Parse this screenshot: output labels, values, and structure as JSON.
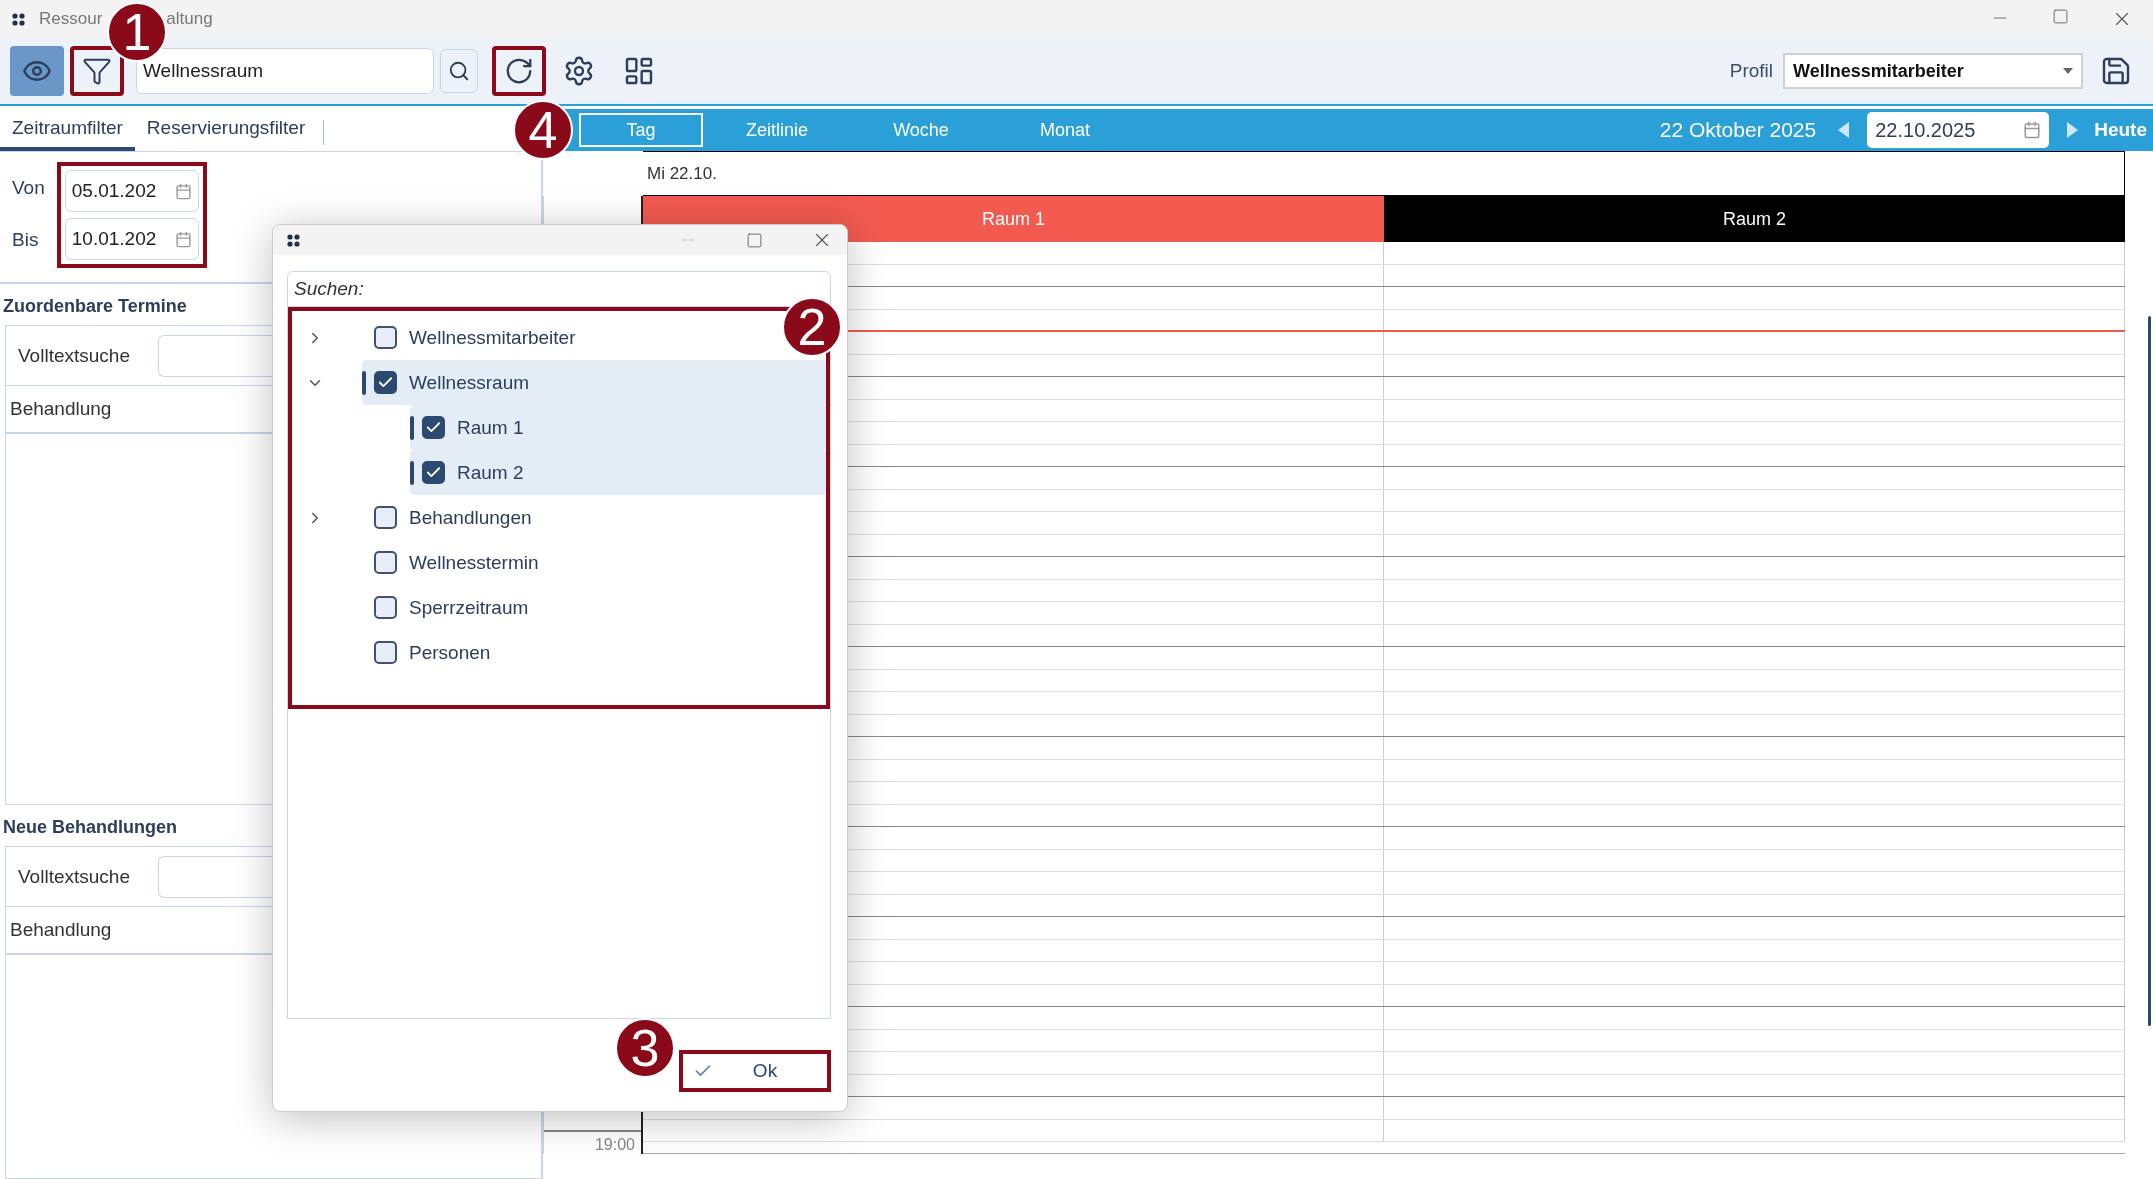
{
  "window": {
    "title_parts": [
      "Ressour",
      "altung"
    ]
  },
  "toolbar": {
    "eye_button": {
      "selected": true
    },
    "filter_button": {
      "highlighted": true
    },
    "search_value": "Wellnessraum",
    "refresh_button": {
      "highlighted": true
    },
    "profile_label": "Profil",
    "profile_value": "Wellnessmitarbeiter"
  },
  "left_panel": {
    "tabs": [
      {
        "label": "Zeitraumfilter",
        "selected": true
      },
      {
        "label": "Reservierungsfilter",
        "selected": false
      }
    ],
    "date_range": {
      "highlighted": true,
      "fields": [
        {
          "label": "Von",
          "value": "05.01.202"
        },
        {
          "label": "Bis",
          "value": "10.01.202"
        }
      ]
    },
    "sections": [
      {
        "title": "Zuordenbare Termine",
        "search_label": "Volltextsuche",
        "column": "Behandlung"
      },
      {
        "title": "Neue Behandlungen",
        "search_label": "Volltextsuche",
        "column": "Behandlung"
      }
    ]
  },
  "calendar": {
    "views": [
      {
        "label": "Tag",
        "selected": true
      },
      {
        "label": "Zeitlinie",
        "selected": false
      },
      {
        "label": "Woche",
        "selected": false
      },
      {
        "label": "Monat",
        "selected": false
      }
    ],
    "date_title": "22 Oktober 2025",
    "date_value": "22.10.2025",
    "today_label": "Heute",
    "day_header": "Mi 22.10.",
    "resources": [
      {
        "name": "Raum 1",
        "color": "#f25a50"
      },
      {
        "name": "Raum 2",
        "color": "#000000"
      }
    ],
    "time_labels": [
      "19:00"
    ]
  },
  "dialog": {
    "search_placeholder": "Suchen:",
    "tree": {
      "highlighted": true,
      "items": [
        {
          "label": "Wellnessmitarbeiter",
          "checked": false,
          "expanded": false,
          "selected": false
        },
        {
          "label": "Wellnessraum",
          "checked": true,
          "expanded": true,
          "selected": true,
          "children": [
            {
              "label": "Raum 1",
              "checked": true,
              "selected": true
            },
            {
              "label": "Raum 2",
              "checked": true,
              "selected": true
            }
          ]
        },
        {
          "label": "Behandlungen",
          "checked": false,
          "expanded": false,
          "selected": false
        },
        {
          "label": "Wellnesstermin",
          "checked": false,
          "selected": false
        },
        {
          "label": "Sperrzeitraum",
          "checked": false,
          "selected": false
        },
        {
          "label": "Personen",
          "checked": false,
          "selected": false
        }
      ]
    },
    "ok_button": {
      "label": "Ok",
      "highlighted": true
    }
  },
  "annotations": [
    {
      "number": "1"
    },
    {
      "number": "2"
    },
    {
      "number": "3"
    },
    {
      "number": "4"
    }
  ]
}
